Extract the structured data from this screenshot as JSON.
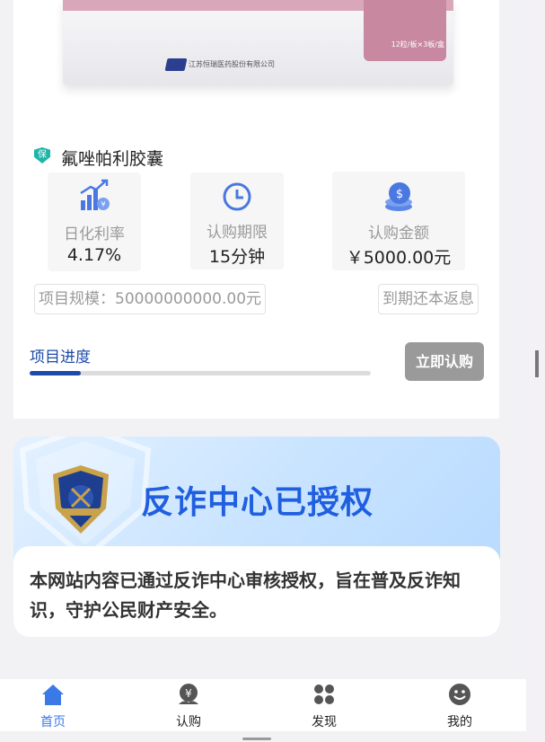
{
  "product": {
    "image": {
      "pack_spec": "12粒/板×3板/盒",
      "maker_name": "江苏恒瑞医药股份有限公司"
    },
    "badge": "保",
    "name": "氟唑帕利胶囊",
    "stats": [
      {
        "icon": "growth-chart-icon",
        "label": "日化利率",
        "value": "4.17%"
      },
      {
        "icon": "clock-icon",
        "label": "认购期限",
        "value": "15分钟"
      },
      {
        "icon": "coins-icon",
        "label": "认购金额",
        "value": "￥5000.00元"
      }
    ],
    "scale": "项目规模：50000000000.00元",
    "repayment": "到期还本返息",
    "progress_label": "项目进度",
    "progress": 0.15,
    "buy_button": "立即认购"
  },
  "fraud_card": {
    "title": "反诈中心已授权",
    "body": "本网站内容已通过反诈中心审核授权，旨在普及反诈知识，守护公民财产安全。"
  },
  "tab_bar": [
    {
      "icon": "home-icon",
      "label": "首页",
      "active": true
    },
    {
      "icon": "subscribe-icon",
      "label": "认购",
      "active": false
    },
    {
      "icon": "discover-icon",
      "label": "发现",
      "active": false
    },
    {
      "icon": "smiley-icon",
      "label": "我的",
      "active": false
    }
  ],
  "colors": {
    "accent": "#1d4aa8",
    "tab_active": "#3b79e6",
    "fraud_title": "#1f5fe0",
    "button_disabled": "#9a9a9a"
  }
}
